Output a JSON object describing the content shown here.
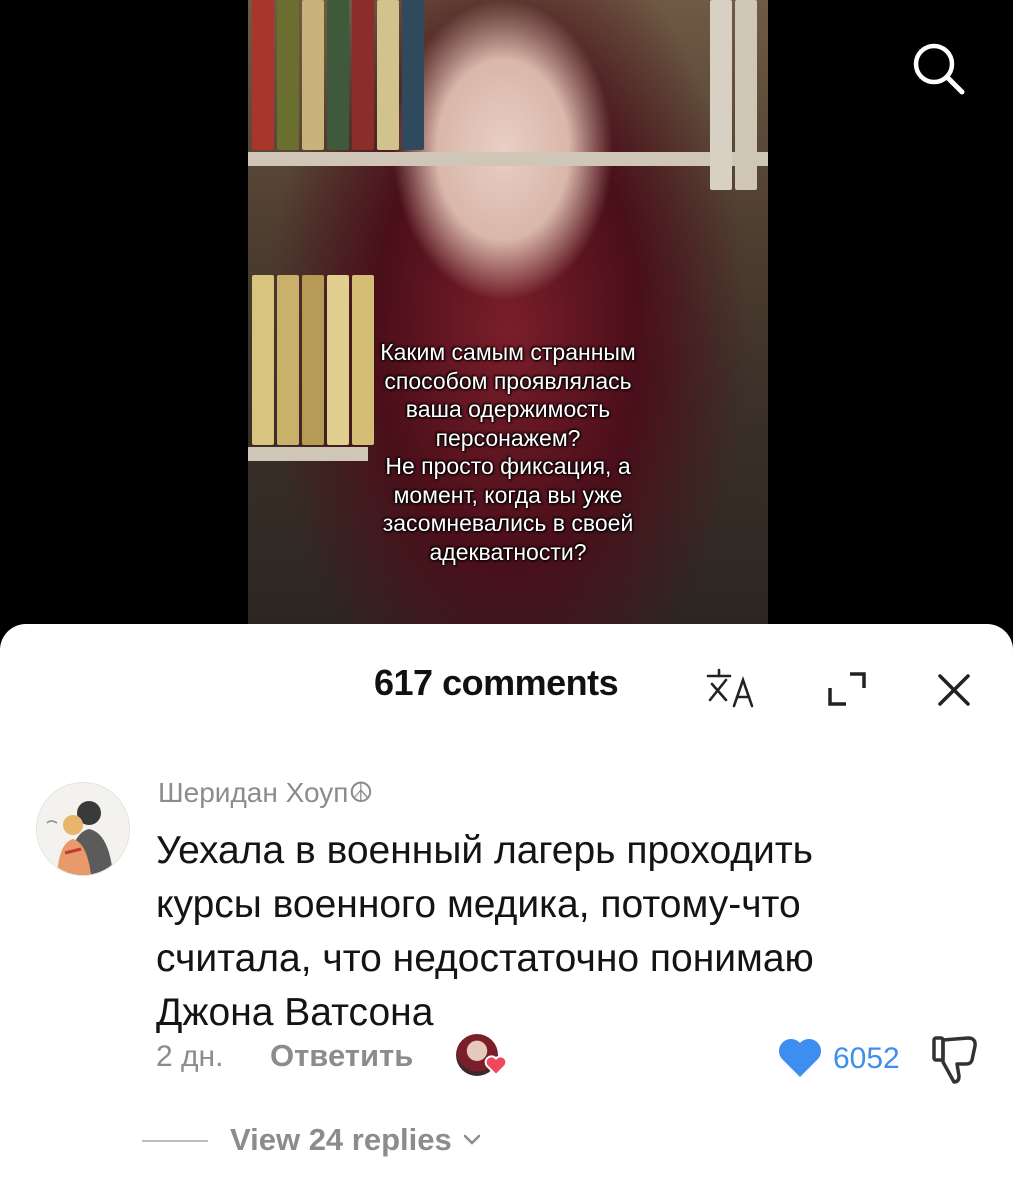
{
  "video": {
    "overlay_lines": [
      "Каким самым странным",
      "способом проявлялась",
      "ваша одержимость",
      "персонажем?",
      "Не просто фиксация, а",
      "момент, когда вы уже",
      "засомневались в своей",
      "адекватности?"
    ],
    "search_icon": "search-icon"
  },
  "comments": {
    "title": "617 comments",
    "header_icons": [
      "translate-icon",
      "expand-icon",
      "close-icon"
    ],
    "items": [
      {
        "author": "Шеридан Хоуп☮",
        "text_lines": [
          "Уехала в военный лагерь проходить",
          "курсы военного медика, потому-что",
          "считала, что недостаточно понимаю",
          "Джона Ватсона"
        ],
        "time": "2 дн.",
        "reply_label": "Ответить",
        "likes": "6052",
        "liked_by_creator": true,
        "view_replies": "View 24 replies"
      }
    ]
  },
  "colors": {
    "like": "#3d8ef0",
    "creator_heart": "#f0475f",
    "muted_text": "#8c8c8c",
    "sheet_bg": "#ffffff"
  }
}
